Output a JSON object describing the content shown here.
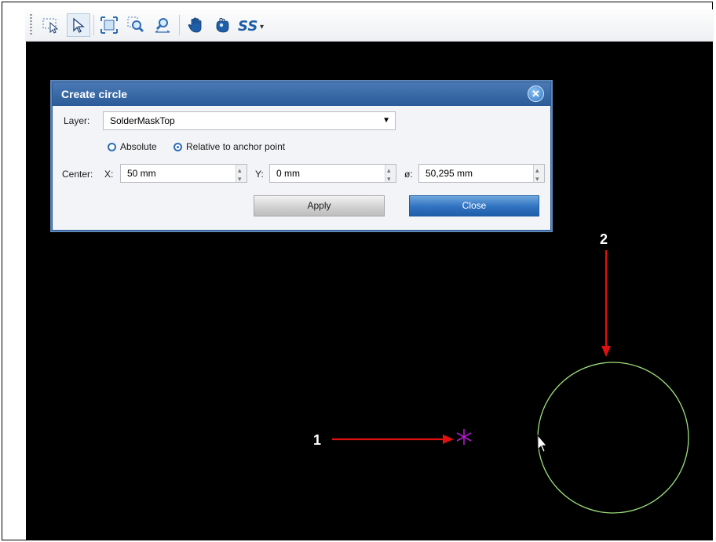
{
  "toolbar": {
    "tools": [
      "select-area-icon",
      "pointer-icon",
      "zoom-fit-icon",
      "zoom-area-icon",
      "zoom-pan-icon",
      "hand-pan-icon",
      "grab-icon",
      "snap-icon"
    ]
  },
  "dialog": {
    "title": "Create circle",
    "layer_label": "Layer:",
    "layer_value": "SolderMaskTop",
    "radio_absolute": "Absolute",
    "radio_relative": "Relative to anchor point",
    "selected_mode": "Relative to anchor point",
    "center_label": "Center:",
    "x_label": "X:",
    "x_value": "50 mm",
    "y_label": "Y:",
    "y_value": "0 mm",
    "diameter_label": "ø:",
    "diameter_value": "50,295 mm",
    "apply_label": "Apply",
    "close_label": "Close"
  },
  "annotations": {
    "callout_1": "1",
    "callout_2": "2",
    "arrow_color": "#e01010",
    "anchor_marker_color": "#b01cc8",
    "circle_color": "#9ee07a"
  },
  "colors": {
    "canvas": "#000000",
    "dialog_title_bar": "#2f5f9c",
    "close_button": "#2f72c0"
  }
}
